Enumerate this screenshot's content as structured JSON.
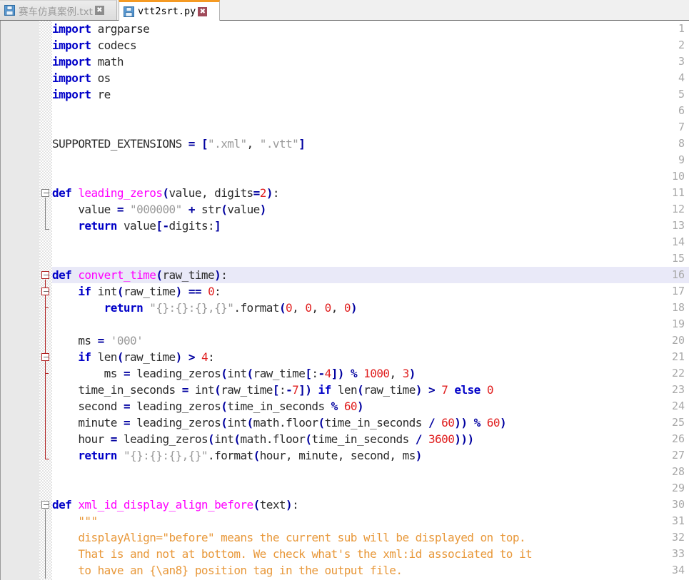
{
  "window": {
    "app_kind": "code-editor",
    "accent_color": "#f59a23",
    "current_line": 16
  },
  "tabs": [
    {
      "label": "赛车仿真案例.txt",
      "icon": "floppy-disk-icon",
      "active": false,
      "close_label": "✖"
    },
    {
      "label": "vtt2srt.py",
      "icon": "floppy-disk-icon",
      "active": true,
      "close_label": "✖"
    }
  ],
  "editor": {
    "language": "Python",
    "first_visible_line": 1,
    "last_visible_line": 34,
    "colors": {
      "keyword": "#0000c8",
      "function": "#ff00ff",
      "string": "#9a9a9a",
      "number": "#e02020",
      "operator": "#0000a0",
      "docstring": "#e8983a",
      "identifier": "#2a2a2a",
      "gutter_bg": "#e9e9e9",
      "lineno": "#a8a8a8",
      "current_line_bg": "#e9e9f8"
    },
    "line_numbers": [
      1,
      2,
      3,
      4,
      5,
      6,
      7,
      8,
      9,
      10,
      11,
      12,
      13,
      14,
      15,
      16,
      17,
      18,
      19,
      20,
      21,
      22,
      23,
      24,
      25,
      26,
      27,
      28,
      29,
      30,
      31,
      32,
      33,
      34
    ],
    "lines": [
      {
        "n": 1,
        "text": "import argparse"
      },
      {
        "n": 2,
        "text": "import codecs"
      },
      {
        "n": 3,
        "text": "import math"
      },
      {
        "n": 4,
        "text": "import os"
      },
      {
        "n": 5,
        "text": "import re"
      },
      {
        "n": 6,
        "text": ""
      },
      {
        "n": 7,
        "text": ""
      },
      {
        "n": 8,
        "text": "SUPPORTED_EXTENSIONS = [\".xml\", \".vtt\"]"
      },
      {
        "n": 9,
        "text": ""
      },
      {
        "n": 10,
        "text": ""
      },
      {
        "n": 11,
        "text": "def leading_zeros(value, digits=2):"
      },
      {
        "n": 12,
        "text": "    value = \"000000\" + str(value)"
      },
      {
        "n": 13,
        "text": "    return value[-digits:]"
      },
      {
        "n": 14,
        "text": ""
      },
      {
        "n": 15,
        "text": ""
      },
      {
        "n": 16,
        "text": "def convert_time(raw_time):"
      },
      {
        "n": 17,
        "text": "    if int(raw_time) == 0:"
      },
      {
        "n": 18,
        "text": "        return \"{}:{}:{},{}\".format(0, 0, 0, 0)"
      },
      {
        "n": 19,
        "text": ""
      },
      {
        "n": 20,
        "text": "    ms = '000'"
      },
      {
        "n": 21,
        "text": "    if len(raw_time) > 4:"
      },
      {
        "n": 22,
        "text": "        ms = leading_zeros(int(raw_time[:-4]) % 1000, 3)"
      },
      {
        "n": 23,
        "text": "    time_in_seconds = int(raw_time[:-7]) if len(raw_time) > 7 else 0"
      },
      {
        "n": 24,
        "text": "    second = leading_zeros(time_in_seconds % 60)"
      },
      {
        "n": 25,
        "text": "    minute = leading_zeros(int(math.floor(time_in_seconds / 60)) % 60)"
      },
      {
        "n": 26,
        "text": "    hour = leading_zeros(int(math.floor(time_in_seconds / 3600)))"
      },
      {
        "n": 27,
        "text": "    return \"{}:{}:{},{}\".format(hour, minute, second, ms)"
      },
      {
        "n": 28,
        "text": ""
      },
      {
        "n": 29,
        "text": ""
      },
      {
        "n": 30,
        "text": "def xml_id_display_align_before(text):"
      },
      {
        "n": 31,
        "text": "    \"\"\""
      },
      {
        "n": 32,
        "text": "    displayAlign=\"before\" means the current sub will be displayed on top."
      },
      {
        "n": 33,
        "text": "    That is and not at bottom. We check what's the xml:id associated to it"
      },
      {
        "n": 34,
        "text": "    to have an {\\an8} position tag in the output file."
      }
    ],
    "fold_markers": [
      {
        "line": 11,
        "state": "expanded",
        "color": "gray"
      },
      {
        "line": 16,
        "state": "expanded",
        "color": "red"
      },
      {
        "line": 17,
        "state": "expanded",
        "color": "red"
      },
      {
        "line": 21,
        "state": "expanded",
        "color": "red"
      },
      {
        "line": 30,
        "state": "expanded",
        "color": "gray"
      }
    ]
  }
}
